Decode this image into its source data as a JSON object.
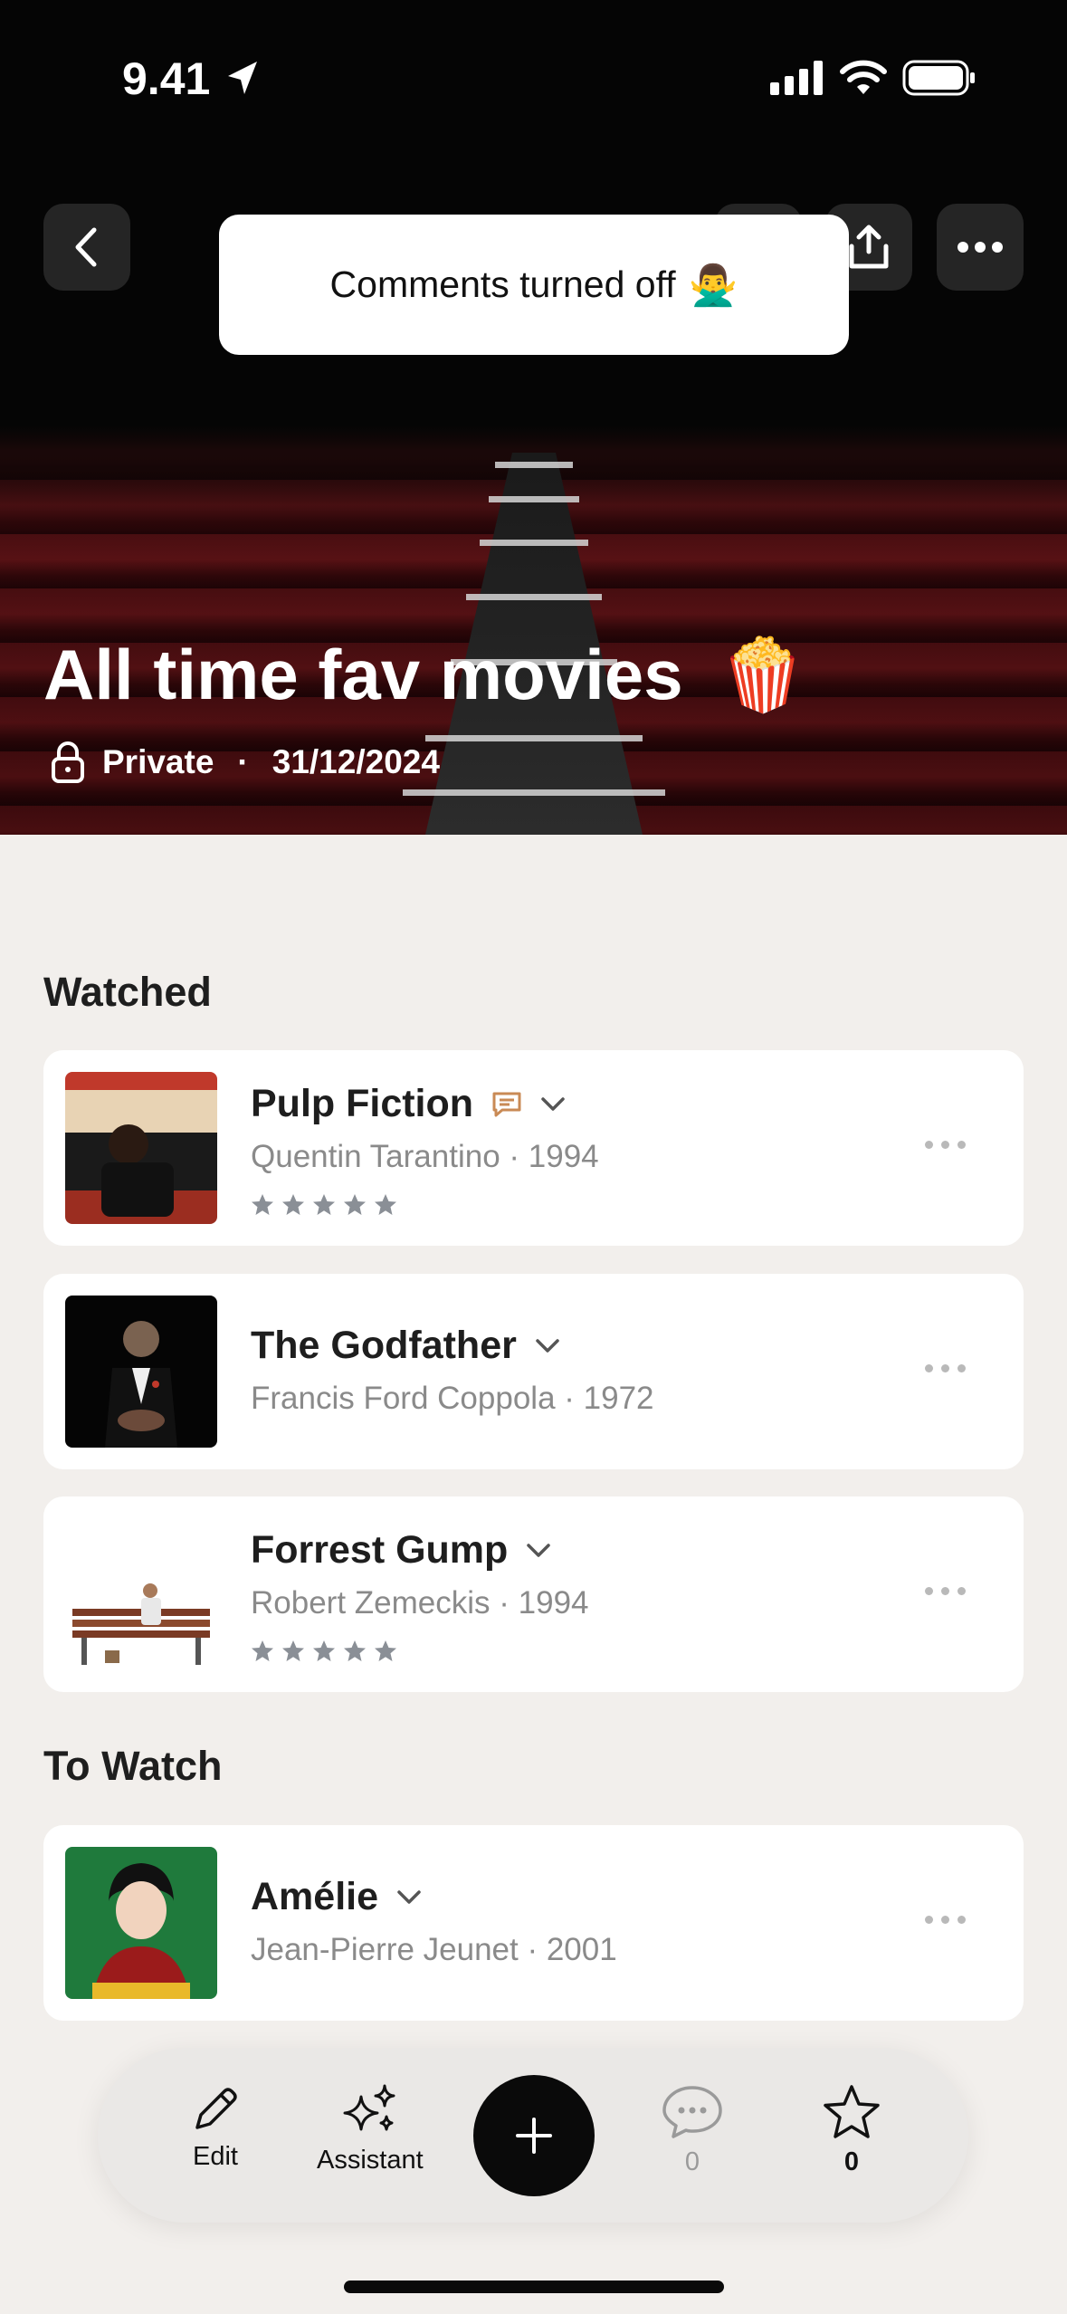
{
  "status_bar": {
    "time": "9.41"
  },
  "toast": {
    "text": "Comments turned off",
    "emoji": "🙅‍♂️"
  },
  "hero": {
    "title": "All time fav movies",
    "title_emoji": "🍿",
    "privacy": "Private",
    "separator": "·",
    "date": "31/12/2024"
  },
  "sections": [
    {
      "title": "Watched",
      "items": [
        {
          "title": "Pulp Fiction",
          "director": "Quentin Tarantino",
          "year": "1994",
          "has_comment": true,
          "rating_stars": 5
        },
        {
          "title": "The Godfather",
          "director": "Francis Ford Coppola",
          "year": "1972",
          "has_comment": false,
          "rating_stars": 0
        },
        {
          "title": "Forrest Gump",
          "director": "Robert Zemeckis",
          "year": "1994",
          "has_comment": false,
          "rating_stars": 5
        }
      ]
    },
    {
      "title": "To Watch",
      "items": [
        {
          "title": "Amélie",
          "director": "Jean-Pierre Jeunet",
          "year": "2001",
          "has_comment": false,
          "rating_stars": 0
        }
      ]
    }
  ],
  "subtitle_sep": " · ",
  "tabbar": {
    "edit_label": "Edit",
    "assistant_label": "Assistant",
    "comments_count": "0",
    "stars_count": "0"
  },
  "colors": {
    "accent_comment": "#c98a55",
    "star_gray": "#8a8f96",
    "tab_bg": "#eae8e6"
  }
}
